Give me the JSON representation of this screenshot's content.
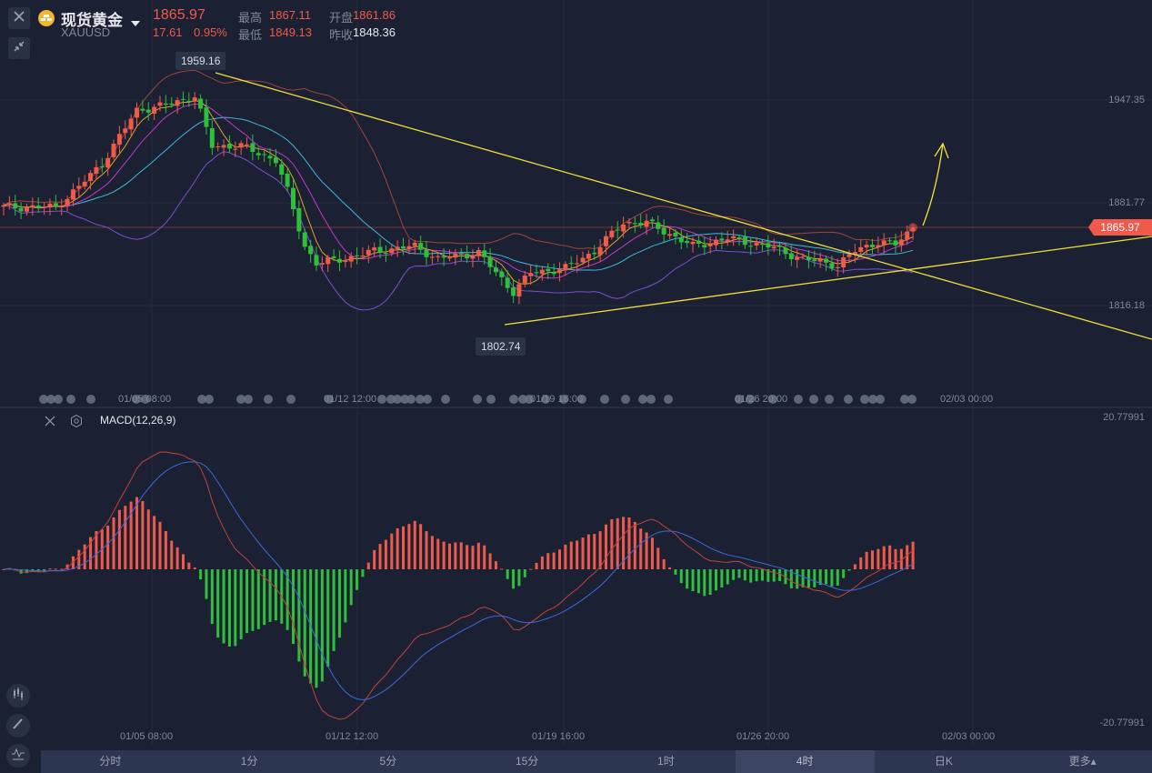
{
  "header": {
    "title": "现货黄金",
    "symbol": "XAUUSD",
    "price": "1865.97",
    "change": "17.61",
    "change_pct": "0.95%",
    "high_label": "最高",
    "high": "1867.11",
    "open_label": "开盘",
    "open": "1861.86",
    "low_label": "最低",
    "low": "1849.13",
    "prev_close_label": "昨收",
    "prev_close": "1848.36"
  },
  "price_axis": [
    "1947.35",
    "1881.77",
    "1816.18"
  ],
  "current_price_tag": "1865.97",
  "annotations": {
    "high_marker": "1959.16",
    "low_marker": "1802.74"
  },
  "time_axis": [
    "01/05 08:00",
    "01/12 12:00",
    "01/19 16:00",
    "01/26 20:00",
    "02/03 00:00"
  ],
  "macd": {
    "label": "MACD(12,26,9)",
    "axis_top": "20.77991",
    "axis_bottom": "-20.77991"
  },
  "tabs": [
    {
      "label": "分时",
      "active": false
    },
    {
      "label": "1分",
      "active": false
    },
    {
      "label": "5分",
      "active": false
    },
    {
      "label": "15分",
      "active": false
    },
    {
      "label": "1时",
      "active": false
    },
    {
      "label": "4时",
      "active": true
    },
    {
      "label": "日K",
      "active": false
    },
    {
      "label": "更多▴",
      "active": false
    }
  ],
  "colors": {
    "up": "#f05a4a",
    "down": "#2fbf3a",
    "trendline": "#f2e03a",
    "background": "#1b2132"
  },
  "chart_data": {
    "type": "candlestick",
    "bars": 158,
    "close_anchors": [
      [
        0,
        1879
      ],
      [
        9,
        1879
      ],
      [
        13,
        1892
      ],
      [
        17,
        1907
      ],
      [
        20,
        1924
      ],
      [
        23,
        1941
      ],
      [
        28,
        1944
      ],
      [
        33,
        1950
      ],
      [
        36,
        1918
      ],
      [
        41,
        1918
      ],
      [
        47,
        1909
      ],
      [
        49,
        1889
      ],
      [
        52,
        1854
      ],
      [
        54,
        1843
      ],
      [
        60,
        1847
      ],
      [
        64,
        1851
      ],
      [
        71,
        1854
      ],
      [
        75,
        1846
      ],
      [
        82,
        1850
      ],
      [
        85,
        1837
      ],
      [
        88,
        1825
      ],
      [
        91,
        1837
      ],
      [
        97,
        1840
      ],
      [
        102,
        1851
      ],
      [
        107,
        1869
      ],
      [
        111,
        1869
      ],
      [
        116,
        1860
      ],
      [
        119,
        1854
      ],
      [
        125,
        1859
      ],
      [
        132,
        1854
      ],
      [
        138,
        1846
      ],
      [
        144,
        1842
      ],
      [
        147,
        1851
      ],
      [
        151,
        1857
      ],
      [
        154,
        1855
      ],
      [
        157,
        1866
      ]
    ],
    "overlays": [
      "MA5",
      "MA10",
      "MA20",
      "BOLL upper",
      "BOLL lower"
    ],
    "trendlines": [
      {
        "from": [
          1959.16,
          36
        ],
        "to": [
          1803,
          157
        ],
        "role": "resistance"
      },
      {
        "from": [
          1802.74,
          87
        ],
        "to": [
          1857,
          157
        ],
        "role": "support"
      }
    ],
    "indicator": "MACD(12,26,9)",
    "macd_range": [
      -20.77991,
      20.77991
    ]
  }
}
